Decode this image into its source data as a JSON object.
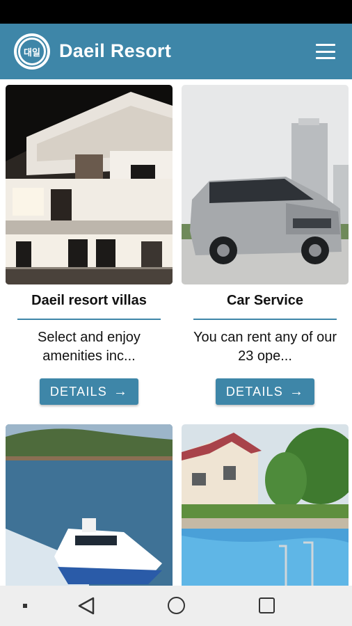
{
  "app": {
    "title": "Daeil Resort",
    "logo_text": "대일"
  },
  "theme": {
    "primary": "#3e86a8",
    "status_bar": "#000000",
    "nav_bar": "#eeeeee"
  },
  "cards": [
    {
      "title": "Daeil resort villas",
      "description": "Select and enjoy amenities inc...",
      "button": "DETAILS",
      "image": "night-villa-photo"
    },
    {
      "title": "Car Service",
      "description": "You can rent any of our 23 ope...",
      "button": "DETAILS",
      "image": "silver-van-photo"
    },
    {
      "image": "yacht-sea-photo"
    },
    {
      "image": "pool-house-photo"
    }
  ],
  "navigation": {
    "icons": [
      "dot-icon",
      "back-icon",
      "home-icon",
      "recent-apps-icon"
    ]
  }
}
